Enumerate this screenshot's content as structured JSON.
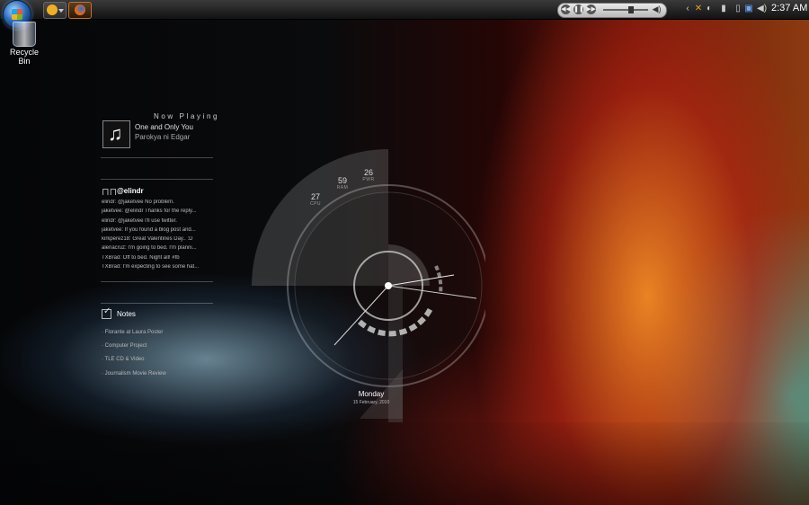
{
  "taskbar": {
    "clock": "2:37 AM",
    "quick_launch": [
      "smiley-icon",
      "firefox-icon"
    ],
    "media": {
      "prev": "◀◀",
      "pause": "❚❚",
      "next": "▶▶"
    },
    "tray_icons": [
      "chevron-icon",
      "x-icon",
      "network-icon",
      "battery-icon",
      "monitor-icon",
      "volume-icon"
    ]
  },
  "desktop": {
    "recycle_bin_label": "Recycle Bin"
  },
  "now_playing": {
    "title": "Now Playing",
    "song": "One and Only You",
    "artist": "Parokya ni Edgar",
    "art_icon": "♫"
  },
  "twitter": {
    "username": "@elindr",
    "tweets": [
      "elindr: @jaketvee No problem.",
      "jaketvee: @elindr Thanks for the reply...",
      "elindr: @jaketvee I'll use twitter.",
      "jaketvee: If you found a blog post and...",
      "kirkperez18: Great Valentines Day.. :D",
      "alenacruz: I'm going to bed. I'm planni...",
      "TXBrad: Off to bed. Night all! #fb",
      "TXBrad: I'm expecting to see some hat..."
    ]
  },
  "notes": {
    "title": "Notes",
    "items": [
      "· Florante at Laura Poster",
      "· Computer Project",
      "· TLE CD & Video",
      "· Journalism Movie Review"
    ]
  },
  "system_widget": {
    "cpu_value": "27",
    "cpu_label": "CPU",
    "ram_value": "59",
    "ram_label": "RAM",
    "pwr_value": "26",
    "pwr_label": "PWR",
    "day": "Monday",
    "date": "15 February, 2010"
  }
}
